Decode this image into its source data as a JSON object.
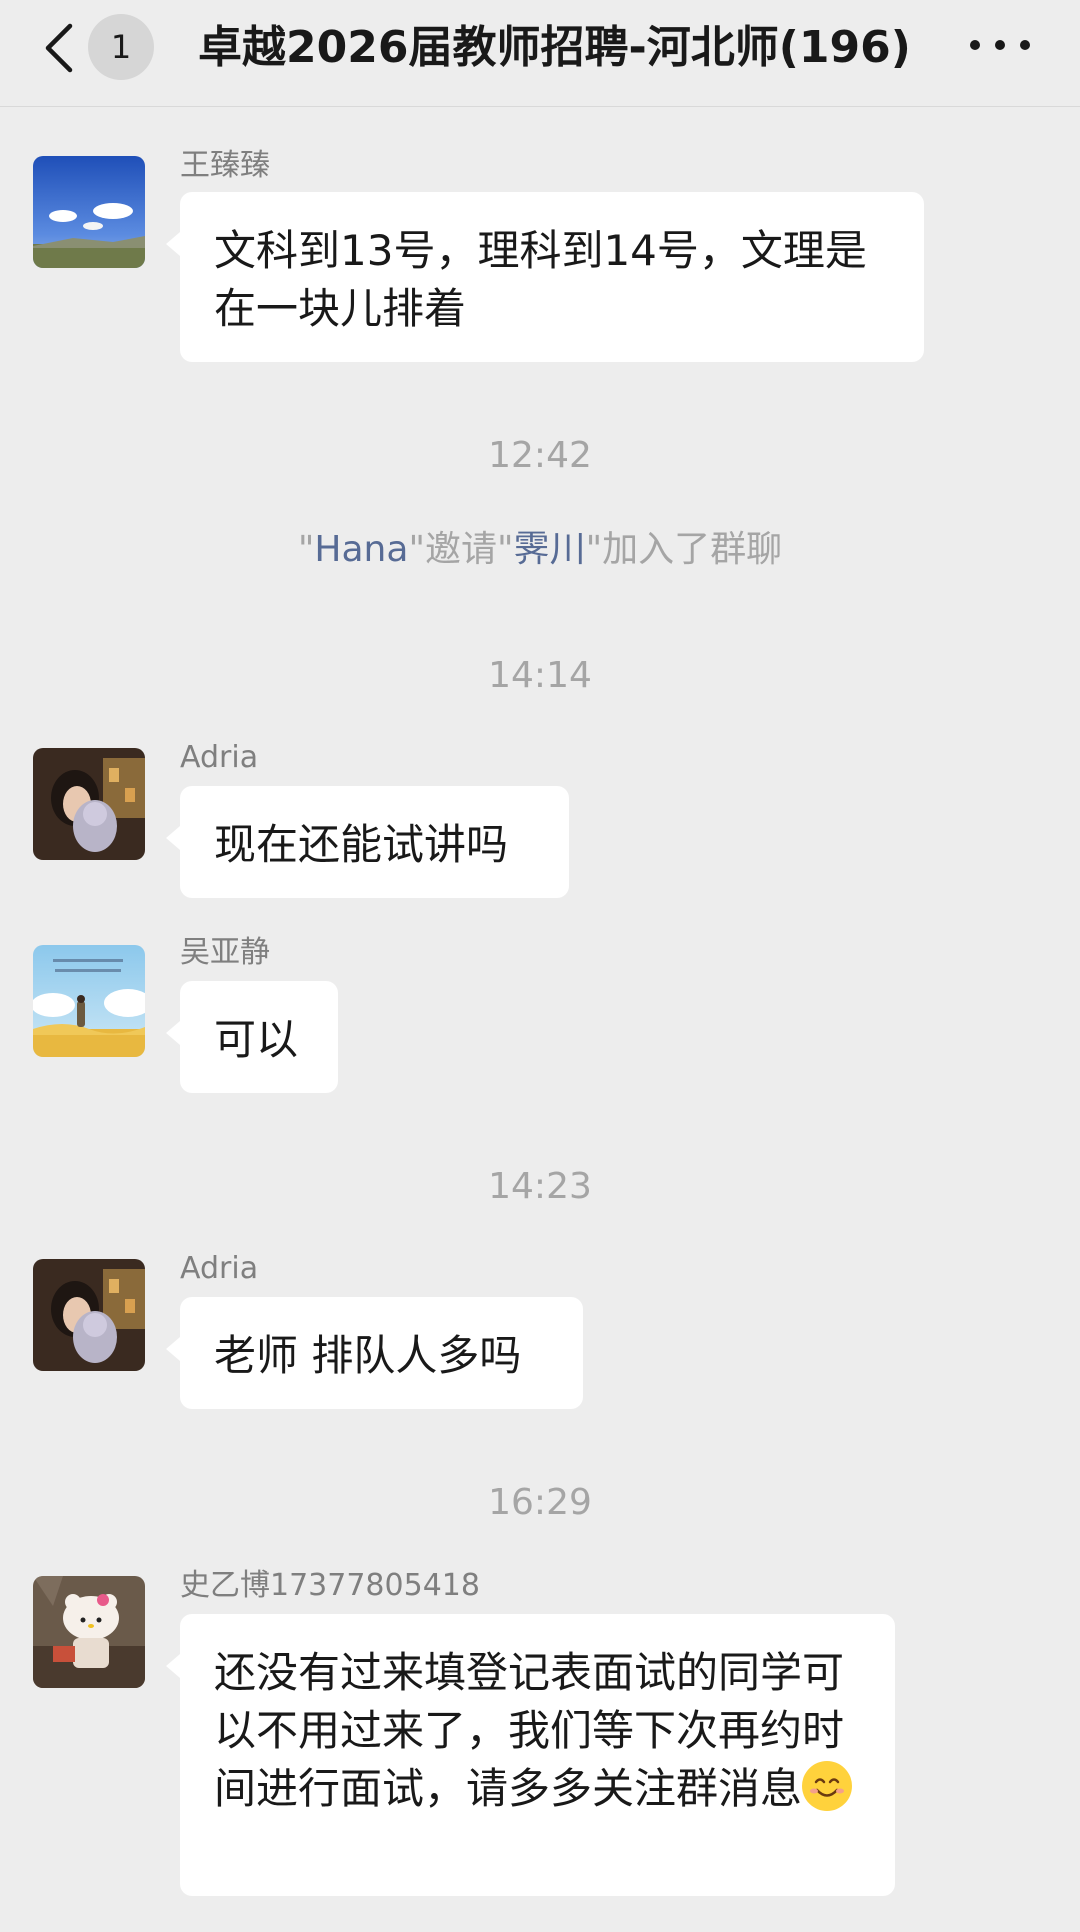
{
  "header": {
    "unread_count": "1",
    "title": "卓越2026届教师招聘-河北师",
    "member_count": "(196)"
  },
  "messages": [
    {
      "sender": "王臻臻",
      "text": "文科到13号，理科到14号，文理是在一块儿排着"
    },
    {
      "time": "12:42"
    },
    {
      "system": {
        "q1": "\"",
        "inviter": "Hana",
        "q2": "\"邀请\"",
        "invitee": "霁川",
        "q3": "\"加入了群聊"
      }
    },
    {
      "time": "14:14"
    },
    {
      "sender": "Adria",
      "text": "现在还能试讲吗"
    },
    {
      "sender": "吴亚静",
      "text": "可以"
    },
    {
      "time": "14:23"
    },
    {
      "sender": "Adria",
      "text": "老师 排队人多吗"
    },
    {
      "time": "16:29"
    },
    {
      "sender": "史乙博17377805418",
      "text": "还没有过来填登记表面试的同学可以不用过来了，我们等下次再约时间进行面试，请多多关注群消息",
      "emoji": "smile-emoji"
    }
  ],
  "colors": {
    "background": "#ededed",
    "bubble": "#ffffff",
    "link": "#576b95",
    "meta_text": "#a5a5a5"
  }
}
